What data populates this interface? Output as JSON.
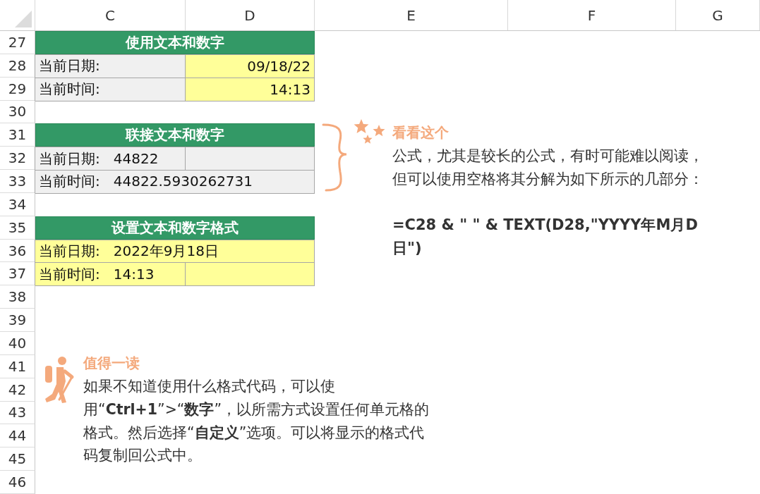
{
  "columns": [
    "C",
    "D",
    "E",
    "F",
    "G"
  ],
  "rows": [
    {
      "number": "27",
      "kind": "title",
      "text": "使用文本和数字"
    },
    {
      "number": "28",
      "kind": "pair",
      "c": {
        "text": "当前日期:",
        "color": "#f0f0f0"
      },
      "d": {
        "text": "09/18/22",
        "color": "#ffff99"
      }
    },
    {
      "number": "29",
      "kind": "pair",
      "c": {
        "text": "当前时间:",
        "color": "#f0f0f0"
      },
      "d": {
        "text": "14:13",
        "color": "#ffff99"
      }
    },
    {
      "number": "30",
      "kind": "blank"
    },
    {
      "number": "31",
      "kind": "title",
      "text": "联接文本和数字"
    },
    {
      "number": "32",
      "kind": "pair",
      "c": {
        "text": "当前日期:   44822",
        "color": "#f0f0f0"
      },
      "d": {
        "color": "#f0f0f0"
      }
    },
    {
      "number": "33",
      "kind": "wide",
      "c": {
        "text": "当前时间:   44822.5930262731",
        "color": "#f0f0f0"
      }
    },
    {
      "number": "34",
      "kind": "blank"
    },
    {
      "number": "35",
      "kind": "title",
      "text": "设置文本和数字格式"
    },
    {
      "number": "36",
      "kind": "wide",
      "c": {
        "text": "当前日期:   2022年9月18日",
        "color": "#ffff99"
      }
    },
    {
      "number": "37",
      "kind": "pair",
      "c": {
        "text": "当前时间:   14:13",
        "color": "#ffff99"
      },
      "d": {
        "color": "#ffff99"
      }
    },
    {
      "number": "38",
      "kind": "blank"
    },
    {
      "number": "39",
      "kind": "blank"
    },
    {
      "number": "40",
      "kind": "blank"
    },
    {
      "number": "41",
      "kind": "blank"
    },
    {
      "number": "42",
      "kind": "blank"
    },
    {
      "number": "43",
      "kind": "blank"
    },
    {
      "number": "44",
      "kind": "blank"
    },
    {
      "number": "45",
      "kind": "blank"
    },
    {
      "number": "46",
      "kind": "blank"
    }
  ],
  "callouts": [
    {
      "kind": "tip",
      "title": "看看这个",
      "body": "公式，尤其是较长的公式，有时可能难以阅读，但可以使用空格将其分解为如下所示的几部分：",
      "formula": "=C28 & \" \" & TEXT(D28,\"YYYY年M月D日\")"
    },
    {
      "kind": "read",
      "title": "值得一读",
      "body": "如果不知道使用什么格式代码，可以使用“**Ctrl+1**”>“**数字**”，以所需方式设置任何单元格的格式。然后选择“**自定义**”选项。可以将显示的格式代码复制回公式中。"
    }
  ]
}
